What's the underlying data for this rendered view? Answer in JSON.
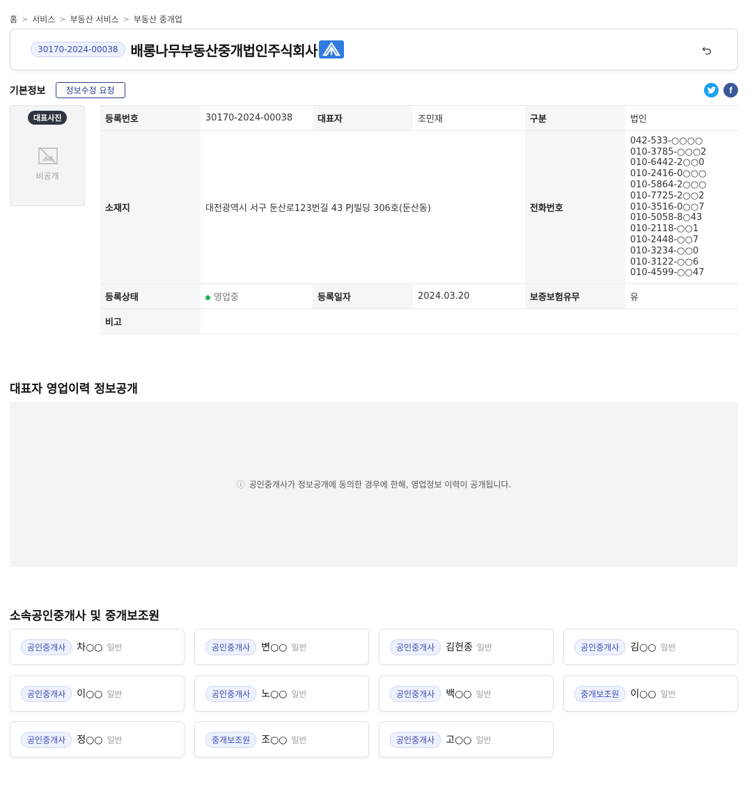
{
  "breadcrumb": [
    "홈",
    "서비스",
    "부동산 서비스",
    "부동산 중개업"
  ],
  "header": {
    "reg_number": "30170-2024-00038",
    "office_name": "배롱나무부동산중개법인주식회사"
  },
  "basic_info": {
    "title": "기본정보",
    "edit_button": "정보수정 요청",
    "photo_badge": "대표사진",
    "photo_private": "비공개",
    "labels": {
      "reg_no": "등록번호",
      "representative": "대표자",
      "category": "구분",
      "address": "소재지",
      "phone": "전화번호",
      "status": "등록상태",
      "reg_date": "등록일자",
      "insurance": "보증보험유무",
      "remarks": "비고"
    },
    "values": {
      "reg_no": "30170-2024-00038",
      "representative": "조민재",
      "category": "법인",
      "address": "대전광역시 서구 둔산로123번길 43 PJ빌딩 306호(둔산동)",
      "phones": [
        "042-533-○○○○",
        "010-3785-○○○2",
        "010-6442-2○○0",
        "010-2416-0○○○",
        "010-5864-2○○○",
        "010-7725-2○○2",
        "010-3516-0○○7",
        "010-5058-8○43",
        "010-2118-○○1",
        "010-2448-○○7",
        "010-3234-○○0",
        "010-3122-○○6",
        "010-4599-○○47"
      ],
      "status": "영업중",
      "reg_date": "2024.03.20",
      "insurance": "유",
      "remarks": ""
    }
  },
  "sales_history": {
    "title": "대표자 영업이력 정보공개",
    "notice": "공인중개사가 정보공개에 동의한 경우에 한해, 영업정보 이력이 공개됩니다."
  },
  "agents": {
    "title": "소속공인중개사 및 중개보조원",
    "items": [
      {
        "role": "공인중개사",
        "name": "차○○",
        "type": "일반"
      },
      {
        "role": "공인중개사",
        "name": "변○○",
        "type": "일반"
      },
      {
        "role": "공인중개사",
        "name": "김헌종",
        "type": "일반"
      },
      {
        "role": "공인중개사",
        "name": "김○○",
        "type": "일반"
      },
      {
        "role": "공인중개사",
        "name": "이○○",
        "type": "일반"
      },
      {
        "role": "공인중개사",
        "name": "노○○",
        "type": "일반"
      },
      {
        "role": "공인중개사",
        "name": "백○○",
        "type": "일반"
      },
      {
        "role": "중개보조원",
        "name": "이○○",
        "type": "일반"
      },
      {
        "role": "공인중개사",
        "name": "정○○",
        "type": "일반"
      },
      {
        "role": "중개보조원",
        "name": "조○○",
        "type": "일반"
      },
      {
        "role": "공인중개사",
        "name": "고○○",
        "type": "일반"
      }
    ]
  },
  "colors": {
    "accent": "#3c4bb0",
    "status_active": "#1db954",
    "twitter": "#1da1f2",
    "facebook": "#3b5998"
  },
  "icons": [
    "back-arrow-icon",
    "twitter-icon",
    "facebook-icon",
    "no-image-icon",
    "info-icon",
    "logo-icon"
  ]
}
